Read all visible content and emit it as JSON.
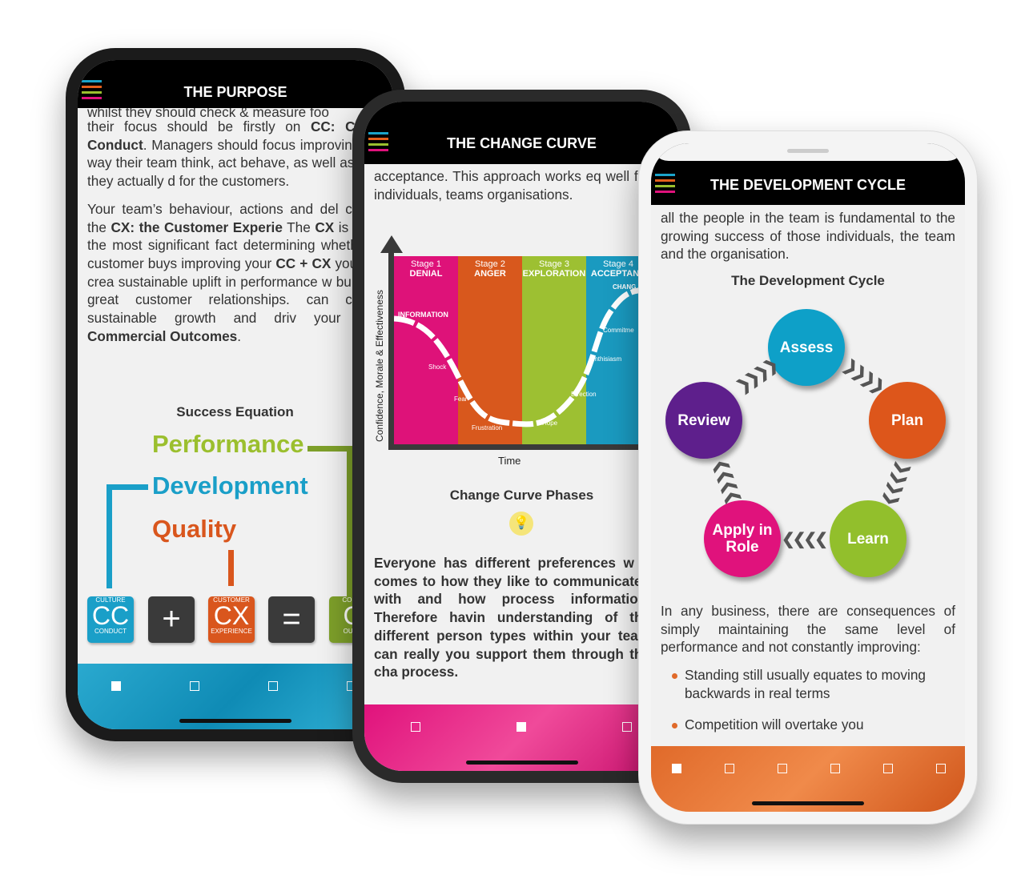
{
  "menu_colors": [
    "#1ba3c9",
    "#e35f1c",
    "#9bbf2e",
    "#e0127c"
  ],
  "phone1": {
    "title": "THE PURPOSE",
    "cut_line": "whilst they should check & measure foo",
    "para1": [
      {
        "t": "their focus should be firstly on "
      },
      {
        "b": "CC: Cu"
      },
      {
        "t": " "
      },
      {
        "b": "& Conduct"
      },
      {
        "t": ". Managers should focus improving the way their team think, act behave, as well as how they actually d for the customers."
      }
    ],
    "para2": [
      {
        "t": "Your team’s behaviour, actions and del create the "
      },
      {
        "b": "CX: the Customer Experie"
      },
      {
        "t": " The "
      },
      {
        "b": "CX"
      },
      {
        "t": " is often the most significant fact determining whether a customer buys improving your "
      },
      {
        "b": "CC + CX"
      },
      {
        "t": " you can crea sustainable uplift in performance w building great customer relationships. can create sustainable growth and driv your "
      },
      {
        "b": "CO: Commercial Outcomes"
      },
      {
        "t": "."
      }
    ],
    "equation_title": "Success Equation",
    "performance": "Performance",
    "development": "Development",
    "quality": "Quality",
    "tiles": [
      {
        "top": "CULTURE",
        "big": "CC",
        "bottom": "CONDUCT",
        "color": "#1a9fc8"
      },
      {
        "op": "+"
      },
      {
        "top": "CUSTOMER",
        "big": "CX",
        "bottom": "EXPERIENCE",
        "color": "#d9561d"
      },
      {
        "op": "="
      },
      {
        "top": "COMM",
        "big": "C",
        "bottom": "OUTC",
        "color": "#7ea02a"
      }
    ],
    "band_color": "#1ba3c9",
    "dots": 5,
    "active_dot": 0
  },
  "phone2": {
    "title": "THE CHANGE CURVE",
    "intro": "acceptance. This approach works eq well for individuals, teams organisations.",
    "chart": {
      "ylabel": "Confidence, Morale & Effectiveness",
      "xlabel": "Time",
      "stages": [
        {
          "n": "Stage 1",
          "name": "DENIAL",
          "color": "#de1279"
        },
        {
          "n": "Stage 2",
          "name": "ANGER",
          "color": "#d8581d"
        },
        {
          "n": "Stage 3",
          "name": "EXPLORATION",
          "color": "#9dc032"
        },
        {
          "n": "Stage 4",
          "name": "ACCEPTANC",
          "color": "#1a9ac0"
        }
      ],
      "labels": [
        "INFORMATION",
        "Shock",
        "Fear",
        "Frustration",
        "Hope",
        "Direction",
        "Enthisiasm",
        "Commitme",
        "CHANG"
      ]
    },
    "phases_title": "Change Curve Phases",
    "bold_para": "Everyone has different preferences w it comes to how they like to communicated with and how process information. Therefore havin understanding of the different person types within your team can really you support them through the cha process.",
    "band_color": "#e0127c",
    "dots": 3,
    "active_dot": 1
  },
  "phone3": {
    "title": "THE DEVELOPMENT CYCLE",
    "intro": "all the people in the team is fundamental to the growing success of those individuals, the team and the organisation.",
    "cycle_title": "The Development Cycle",
    "cycle": [
      {
        "label": "Assess",
        "color": "#0ea0c8"
      },
      {
        "label": "Plan",
        "color": "#dd561b"
      },
      {
        "label": "Learn",
        "color": "#92bf2c"
      },
      {
        "label": "Apply in Role",
        "color": "#e0127c"
      },
      {
        "label": "Review",
        "color": "#5e1f8c"
      }
    ],
    "para": "In any business, there are consequences of simply maintaining the same level of performance and not constantly improving:",
    "bullets": [
      "Standing still usually equates to moving backwards in real terms",
      "Competition will overtake you"
    ],
    "band_color": "#e06a2a",
    "dots": 6,
    "active_dot": 0
  }
}
